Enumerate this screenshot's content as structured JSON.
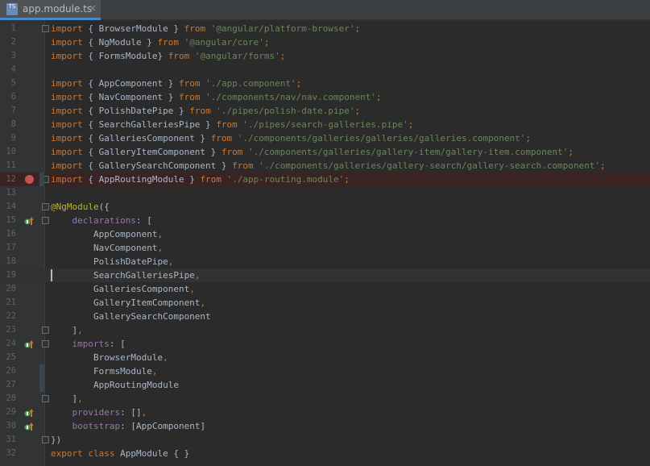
{
  "tab": {
    "icon_label": "TS",
    "filename": "app.module.ts",
    "close": "×"
  },
  "colors": {
    "background": "#2b2b2b",
    "gutter": "#313335",
    "keyword": "#cc7832",
    "string": "#6a8759",
    "annotation": "#bbb529",
    "property": "#9876aa",
    "breakpoint": "#c75450"
  },
  "lines": [
    {
      "n": "1",
      "t": [
        [
          "kw",
          "import"
        ],
        [
          "",
          "{ BrowserModule } "
        ],
        [
          "kw",
          "from"
        ],
        [
          "str",
          " '@angular/platform-browser'"
        ],
        [
          "kw",
          ";"
        ]
      ]
    },
    {
      "n": "2",
      "t": [
        [
          "kw",
          "import"
        ],
        [
          "",
          "{ NgModule } "
        ],
        [
          "kw",
          "from"
        ],
        [
          "str",
          " '@angular/core'"
        ],
        [
          "kw",
          ";"
        ]
      ]
    },
    {
      "n": "3",
      "t": [
        [
          "kw",
          "import"
        ],
        [
          "",
          "{ FormsModule} "
        ],
        [
          "kw",
          "from"
        ],
        [
          "str",
          " '@angular/forms'"
        ],
        [
          "kw",
          ";"
        ]
      ]
    },
    {
      "n": "4",
      "t": []
    },
    {
      "n": "5",
      "t": [
        [
          "kw",
          "import"
        ],
        [
          "",
          "{ AppComponent } "
        ],
        [
          "kw",
          "from"
        ],
        [
          "str",
          " './app.component'"
        ],
        [
          "kw",
          ";"
        ]
      ]
    },
    {
      "n": "6",
      "t": [
        [
          "kw",
          "import"
        ],
        [
          "",
          "{ NavComponent } "
        ],
        [
          "kw",
          "from"
        ],
        [
          "str",
          " './components/nav/nav.component'"
        ],
        [
          "kw",
          ";"
        ]
      ]
    },
    {
      "n": "7",
      "t": [
        [
          "kw",
          "import"
        ],
        [
          "",
          "{ PolishDatePipe } "
        ],
        [
          "kw",
          "from"
        ],
        [
          "str",
          " './pipes/polish-date.pipe'"
        ],
        [
          "kw",
          ";"
        ]
      ]
    },
    {
      "n": "8",
      "t": [
        [
          "kw",
          "import"
        ],
        [
          "",
          "{ SearchGalleriesPipe } "
        ],
        [
          "kw",
          "from"
        ],
        [
          "str",
          " './pipes/search-galleries.pipe'"
        ],
        [
          "kw",
          ";"
        ]
      ]
    },
    {
      "n": "9",
      "t": [
        [
          "kw",
          "import"
        ],
        [
          "",
          "{ GalleriesComponent } "
        ],
        [
          "kw",
          "from"
        ],
        [
          "str",
          " './components/galleries/galleries/galleries.component'"
        ],
        [
          "kw",
          ";"
        ]
      ]
    },
    {
      "n": "10",
      "t": [
        [
          "kw",
          "import"
        ],
        [
          "",
          "{ GalleryItemComponent } "
        ],
        [
          "kw",
          "from"
        ],
        [
          "str",
          " './components/galleries/gallery-item/gallery-item.component'"
        ],
        [
          "kw",
          ";"
        ]
      ]
    },
    {
      "n": "11",
      "t": [
        [
          "kw",
          "import"
        ],
        [
          "",
          "{ GallerySearchComponent } "
        ],
        [
          "kw",
          "from"
        ],
        [
          "str",
          " './components/galleries/gallery-search/gallery-search.component'"
        ],
        [
          "kw",
          ";"
        ]
      ]
    },
    {
      "n": "12",
      "t": [
        [
          "kw",
          "import"
        ],
        [
          "",
          "{ AppRoutingModule } "
        ],
        [
          "kw",
          "from"
        ],
        [
          "str",
          " './app-routing.module'"
        ],
        [
          "kw",
          ";"
        ]
      ]
    },
    {
      "n": "13",
      "t": []
    },
    {
      "n": "14",
      "t": [
        [
          "ann",
          "@NgModule"
        ],
        [
          "",
          "({"
        ]
      ]
    },
    {
      "n": "15",
      "t": [
        [
          "",
          "    "
        ],
        [
          "prop",
          "declarations"
        ],
        [
          "",
          ": ["
        ]
      ]
    },
    {
      "n": "16",
      "t": [
        [
          "",
          "        AppComponent"
        ],
        [
          "kw",
          ","
        ]
      ]
    },
    {
      "n": "17",
      "t": [
        [
          "",
          "        NavComponent"
        ],
        [
          "kw",
          ","
        ]
      ]
    },
    {
      "n": "18",
      "t": [
        [
          "",
          "        PolishDatePipe"
        ],
        [
          "kw",
          ","
        ]
      ]
    },
    {
      "n": "19",
      "t": [
        [
          "",
          "        SearchGalleriesPipe"
        ],
        [
          "kw",
          ","
        ]
      ]
    },
    {
      "n": "20",
      "t": [
        [
          "",
          "        GalleriesComponent"
        ],
        [
          "kw",
          ","
        ]
      ]
    },
    {
      "n": "21",
      "t": [
        [
          "",
          "        GalleryItemComponent"
        ],
        [
          "kw",
          ","
        ]
      ]
    },
    {
      "n": "22",
      "t": [
        [
          "",
          "        GallerySearchComponent"
        ]
      ]
    },
    {
      "n": "23",
      "t": [
        [
          "",
          "    ]"
        ],
        [
          "kw",
          ","
        ]
      ]
    },
    {
      "n": "24",
      "t": [
        [
          "",
          "    "
        ],
        [
          "prop",
          "imports"
        ],
        [
          "",
          ": ["
        ]
      ]
    },
    {
      "n": "25",
      "t": [
        [
          "",
          "        BrowserModule"
        ],
        [
          "kw",
          ","
        ]
      ]
    },
    {
      "n": "26",
      "t": [
        [
          "",
          "        FormsModule"
        ],
        [
          "kw",
          ","
        ]
      ]
    },
    {
      "n": "27",
      "t": [
        [
          "",
          "        AppRoutingModule"
        ]
      ]
    },
    {
      "n": "28",
      "t": [
        [
          "",
          "    ]"
        ],
        [
          "kw",
          ","
        ]
      ]
    },
    {
      "n": "29",
      "t": [
        [
          "",
          "    "
        ],
        [
          "prop",
          "providers"
        ],
        [
          "",
          ": []"
        ],
        [
          "kw",
          ","
        ]
      ]
    },
    {
      "n": "30",
      "t": [
        [
          "",
          "    "
        ],
        [
          "prop",
          "bootstrap"
        ],
        [
          "",
          ": [AppComponent]"
        ]
      ]
    },
    {
      "n": "31",
      "t": [
        [
          "",
          "})"
        ]
      ]
    },
    {
      "n": "32",
      "t": [
        [
          "kw",
          "export class "
        ],
        [
          "",
          "AppModule { }"
        ]
      ]
    }
  ],
  "breakpoint_line": "12",
  "current_line": "19",
  "implement_lines": [
    "15",
    "24",
    "29",
    "30"
  ],
  "fold_lines": [
    "1",
    "12",
    "14",
    "15",
    "23",
    "24",
    "28",
    "31"
  ]
}
